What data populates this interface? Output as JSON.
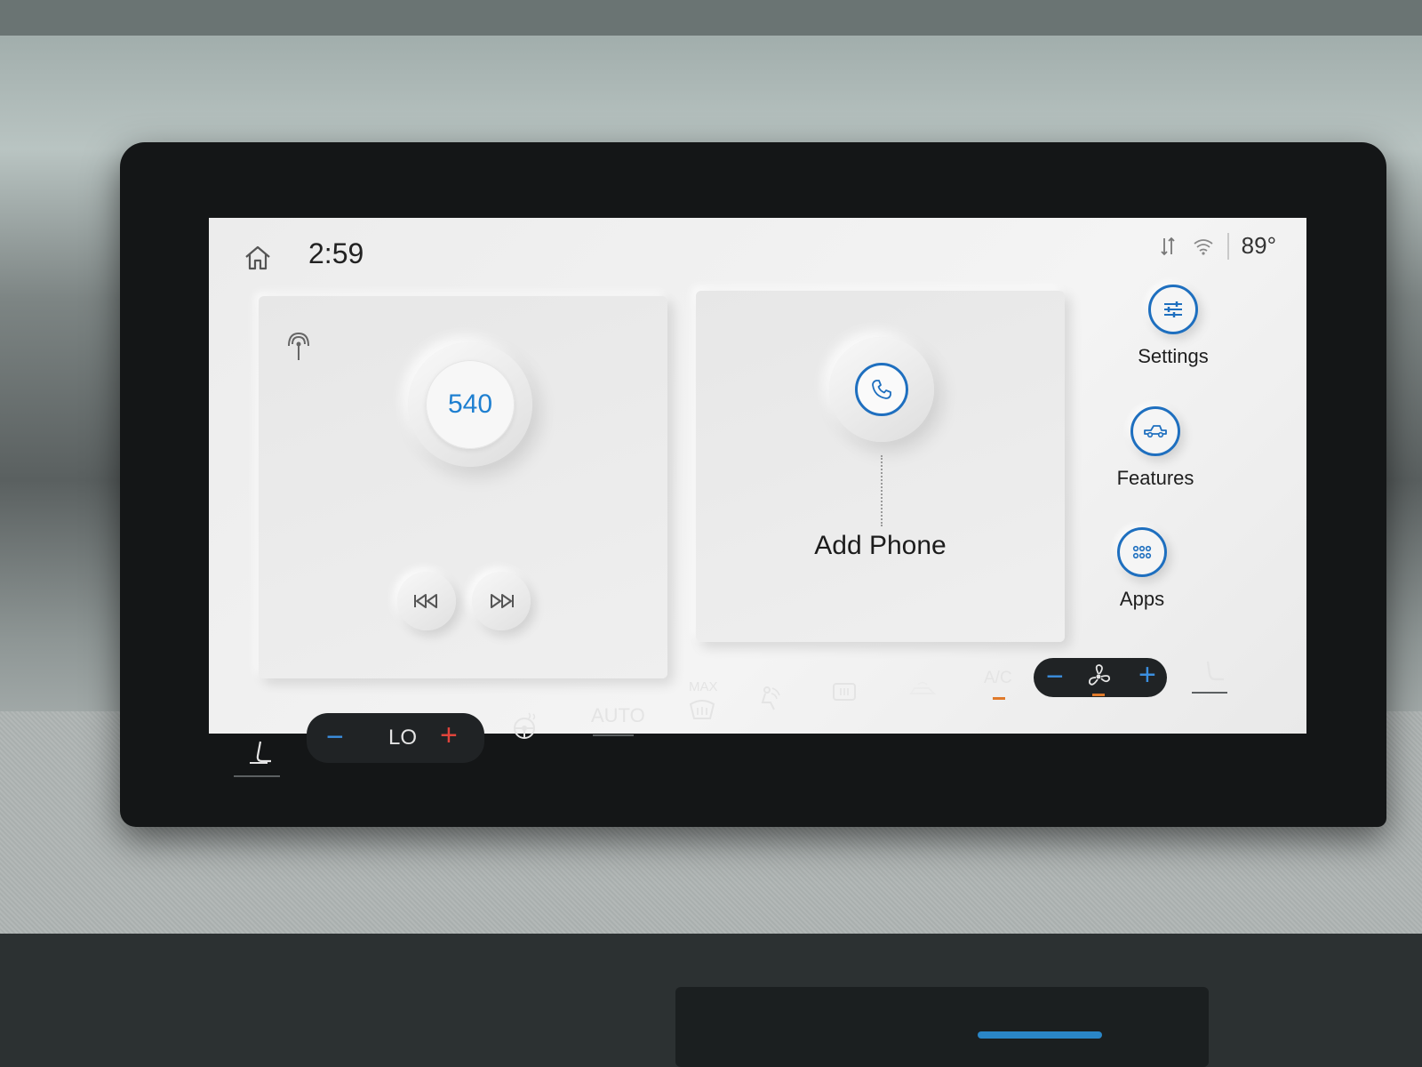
{
  "status_bar": {
    "home_icon": "home-icon",
    "time": "2:59",
    "icons": [
      "data-arrows-icon",
      "wifi-icon"
    ],
    "temperature": "89°"
  },
  "radio_card": {
    "signal_icon": "radio-antenna-icon",
    "station": "540",
    "prev_icon": "skip-back-icon",
    "next_icon": "skip-forward-icon"
  },
  "phone_card": {
    "phone_icon": "phone-icon",
    "label": "Add Phone"
  },
  "side_menu": {
    "items": [
      {
        "label": "Settings",
        "icon": "sliders-icon"
      },
      {
        "label": "Features",
        "icon": "truck-icon"
      },
      {
        "label": "Apps",
        "icon": "grid-dots-icon"
      }
    ]
  },
  "climate": {
    "driver_temp": "LO",
    "minus": "−",
    "plus": "+",
    "auto": "AUTO",
    "max": "MAX",
    "ac": "A/C"
  },
  "colors": {
    "accent_blue": "#1e6fbf",
    "station_blue": "#1e7fd0",
    "plus_red": "#e0443b",
    "indicator_orange": "#e07a2b"
  }
}
